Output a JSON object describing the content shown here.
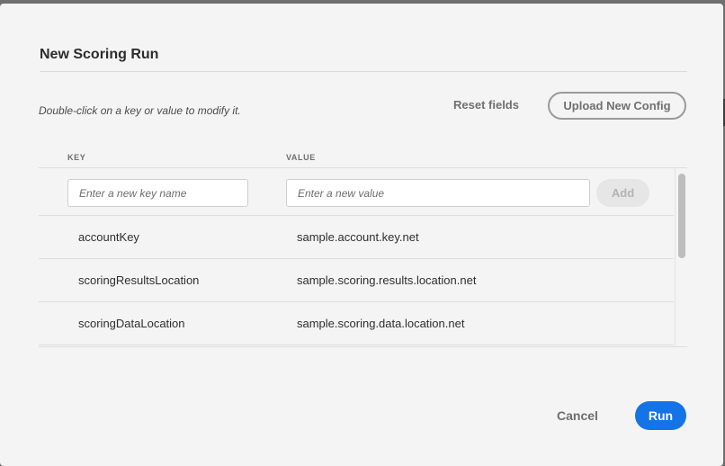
{
  "dialog": {
    "title": "New Scoring Run",
    "hint": "Double-click on a key or value to modify it.",
    "reset_label": "Reset fields",
    "upload_label": "Upload New Config"
  },
  "table": {
    "headers": {
      "key": "KEY",
      "value": "VALUE"
    },
    "new_key_placeholder": "Enter a new key name",
    "new_value_placeholder": "Enter a new value",
    "add_label": "Add",
    "rows": [
      {
        "key": "accountKey",
        "value": "sample.account.key.net"
      },
      {
        "key": "scoringResultsLocation",
        "value": "sample.scoring.results.location.net"
      },
      {
        "key": "scoringDataLocation",
        "value": "sample.scoring.data.location.net"
      }
    ]
  },
  "footer": {
    "cancel_label": "Cancel",
    "run_label": "Run"
  },
  "colors": {
    "accent": "#1473e6",
    "dialog_bg": "#f4f4f4",
    "backdrop": "#6f6f6f"
  }
}
